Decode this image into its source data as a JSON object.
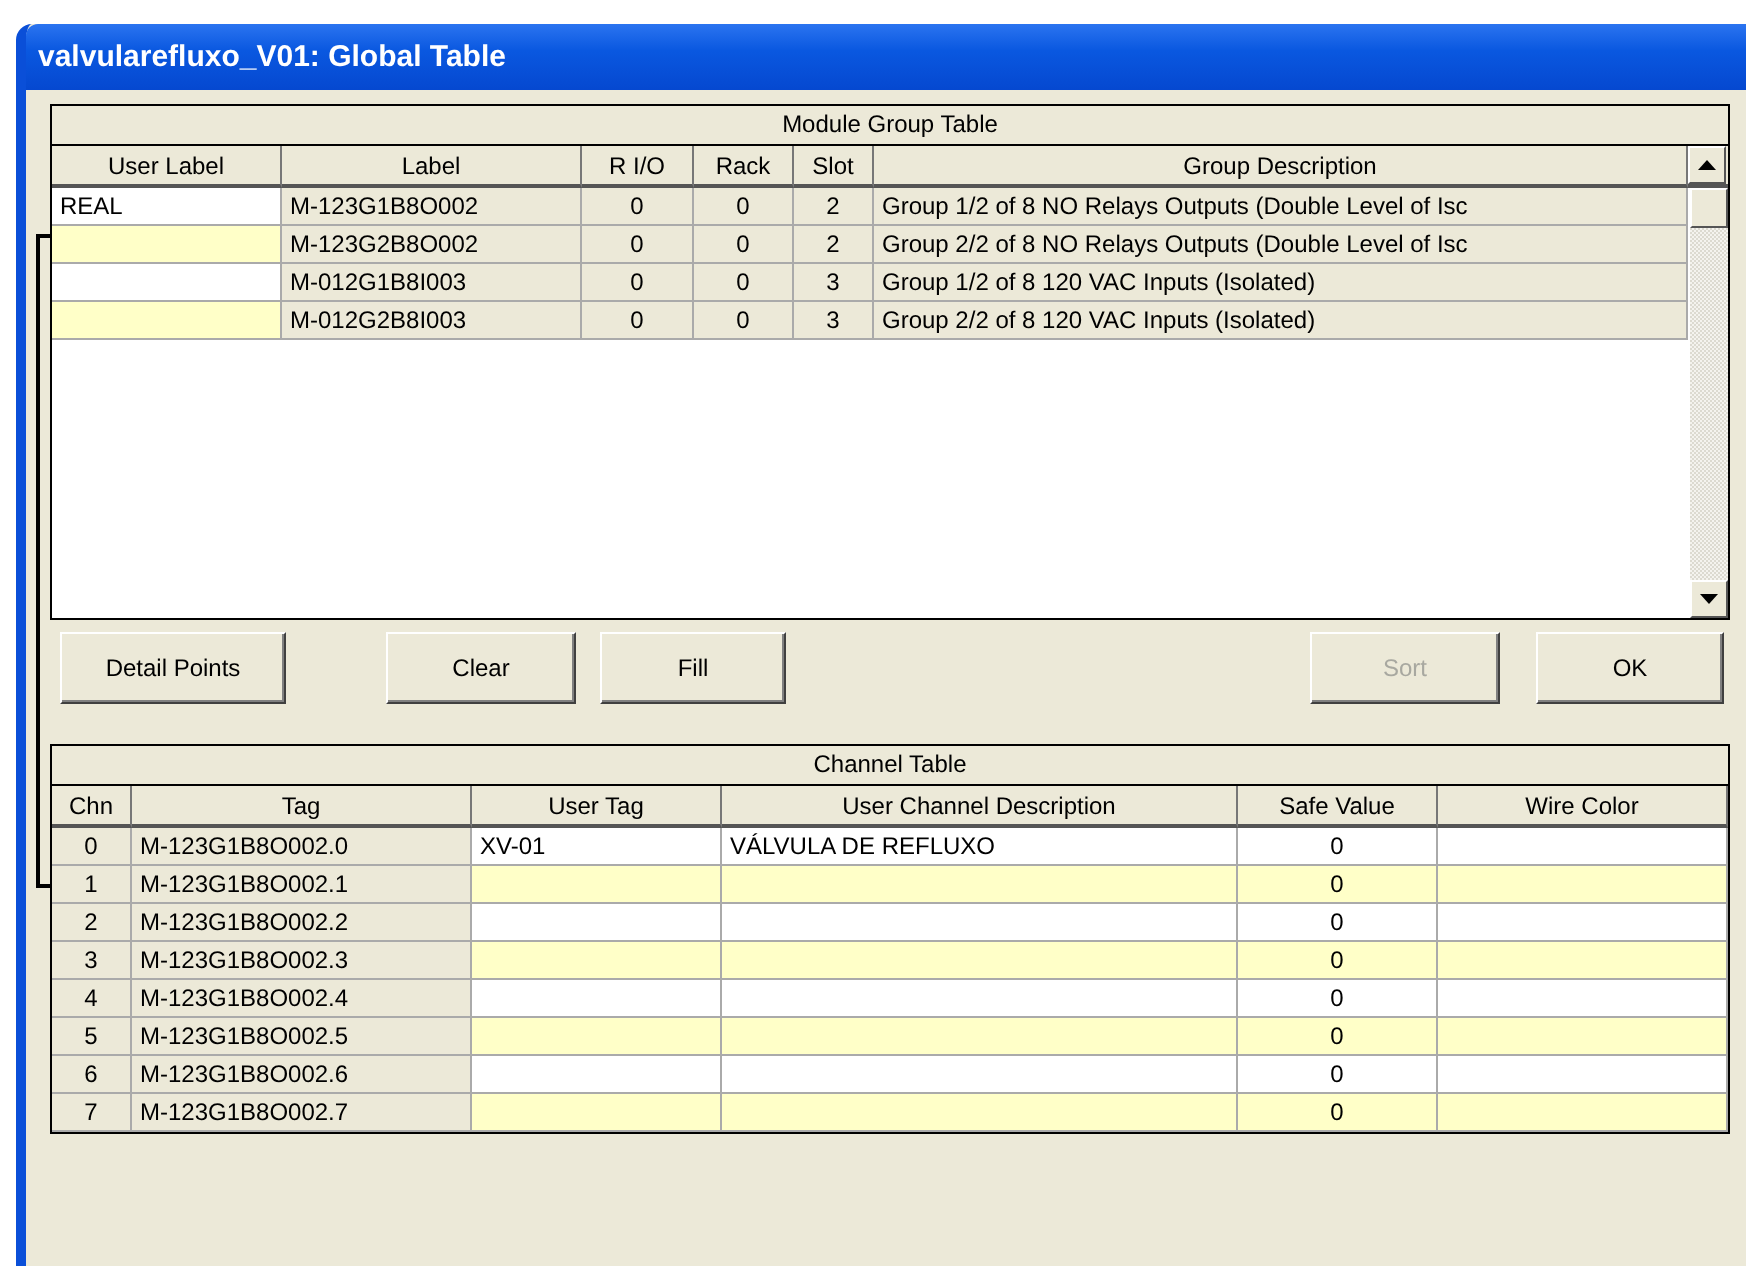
{
  "window": {
    "title": "valvularefluxo_V01: Global Table"
  },
  "module_group_table": {
    "title": "Module Group Table",
    "columns": [
      "User Label",
      "Label",
      "R I/O",
      "Rack",
      "Slot",
      "Group Description"
    ],
    "rows": [
      {
        "user_label": "REAL",
        "label": "M-123G1B8O002",
        "r_io": "0",
        "rack": "0",
        "slot": "2",
        "group_description": "Group 1/2 of 8 NO Relays Outputs (Double Level of Isc",
        "highlighted": false
      },
      {
        "label": "M-123G2B8O002",
        "r_io": "0",
        "rack": "0",
        "slot": "2",
        "group_description": "Group 2/2 of 8 NO Relays Outputs (Double Level of Isc",
        "highlighted": true
      },
      {
        "label": "M-012G1B8I003",
        "r_io": "0",
        "rack": "0",
        "slot": "3",
        "group_description": "Group 1/2 of 8 120 VAC Inputs (Isolated)",
        "highlighted": false
      },
      {
        "label": "M-012G2B8I003",
        "r_io": "0",
        "rack": "0",
        "slot": "3",
        "group_description": "Group 2/2 of 8 120 VAC Inputs (Isolated)",
        "highlighted": true
      }
    ]
  },
  "buttons": [
    {
      "label": "Detail Points",
      "disabled": false
    },
    {
      "label": "Clear",
      "disabled": false
    },
    {
      "label": "Fill",
      "disabled": false
    },
    {
      "label": "Sort",
      "disabled": true
    },
    {
      "label": "OK",
      "disabled": false
    }
  ],
  "channel_table": {
    "title": "Channel Table",
    "columns": [
      "Chn",
      "Tag",
      "User Tag",
      "User Channel Description",
      "Safe Value",
      "Wire Color"
    ],
    "rows": [
      {
        "chn": "0",
        "tag": "M-123G1B8O002.0",
        "user_tag": "XV-01",
        "description": "VÁLVULA DE REFLUXO",
        "safe_value": "0",
        "highlighted": false
      },
      {
        "chn": "1",
        "tag": "M-123G1B8O002.1",
        "safe_value": "0",
        "highlighted": true
      },
      {
        "chn": "2",
        "tag": "M-123G1B8O002.2",
        "safe_value": "0",
        "highlighted": false
      },
      {
        "chn": "3",
        "tag": "M-123G1B8O002.3",
        "safe_value": "0",
        "highlighted": true
      },
      {
        "chn": "4",
        "tag": "M-123G1B8O002.4",
        "safe_value": "0",
        "highlighted": false
      },
      {
        "chn": "5",
        "tag": "M-123G1B8O002.5",
        "safe_value": "0",
        "highlighted": true
      },
      {
        "chn": "6",
        "tag": "M-123G1B8O002.6",
        "safe_value": "0",
        "highlighted": false
      },
      {
        "chn": "7",
        "tag": "M-123G1B8O002.7",
        "safe_value": "0",
        "highlighted": true
      }
    ]
  }
}
